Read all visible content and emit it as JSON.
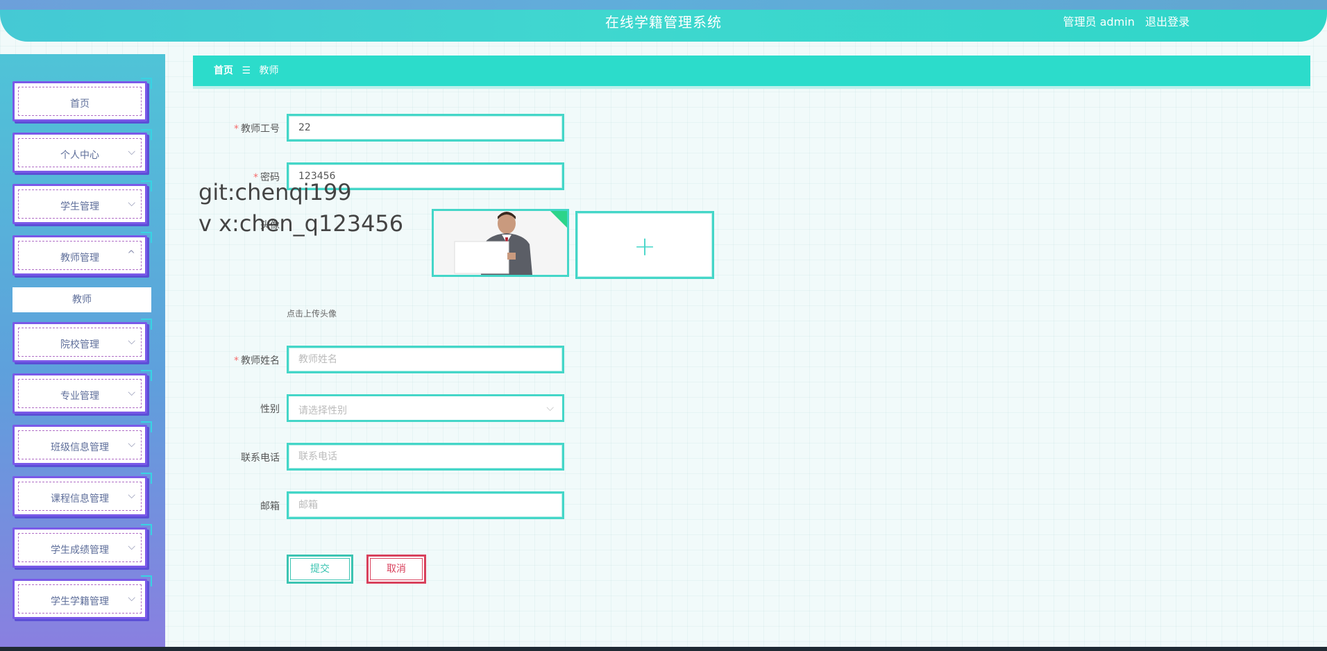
{
  "header": {
    "title": "在线学籍管理系统",
    "role": "管理员 admin",
    "logout_label": "退出登录"
  },
  "sidebar": {
    "items": [
      {
        "label": "首页",
        "has_arrow": false
      },
      {
        "label": "个人中心",
        "has_arrow": true
      },
      {
        "label": "学生管理",
        "has_arrow": true
      },
      {
        "label": "教师管理",
        "has_arrow": true,
        "expanded": true
      },
      {
        "label": "院校管理",
        "has_arrow": true
      },
      {
        "label": "专业管理",
        "has_arrow": true
      },
      {
        "label": "班级信息管理",
        "has_arrow": true
      },
      {
        "label": "课程信息管理",
        "has_arrow": true
      },
      {
        "label": "学生成绩管理",
        "has_arrow": true
      },
      {
        "label": "学生学籍管理",
        "has_arrow": true
      }
    ],
    "sub_item": "教师"
  },
  "breadcrumb": {
    "home": "首页",
    "separator": "☰",
    "current": "教师"
  },
  "form": {
    "teacher_id": {
      "label": "教师工号",
      "value": "22",
      "required": true
    },
    "password": {
      "label": "密码",
      "value": "123456",
      "required": true
    },
    "avatar": {
      "label": "头像",
      "hint": "点击上传头像"
    },
    "name": {
      "label": "教师姓名",
      "placeholder": "教师姓名",
      "required": true
    },
    "gender": {
      "label": "性别",
      "placeholder": "请选择性别"
    },
    "phone": {
      "label": "联系电话",
      "placeholder": "联系电话"
    },
    "email": {
      "label": "邮箱",
      "placeholder": "邮箱"
    },
    "submit_label": "提交",
    "cancel_label": "取消"
  },
  "watermark": {
    "line1": "git:chenqi199",
    "line2": "v x:chen_q123456"
  },
  "colors": {
    "accent": "#2cdccb",
    "menu_border": "#7a59e8",
    "danger": "#d8415c"
  }
}
